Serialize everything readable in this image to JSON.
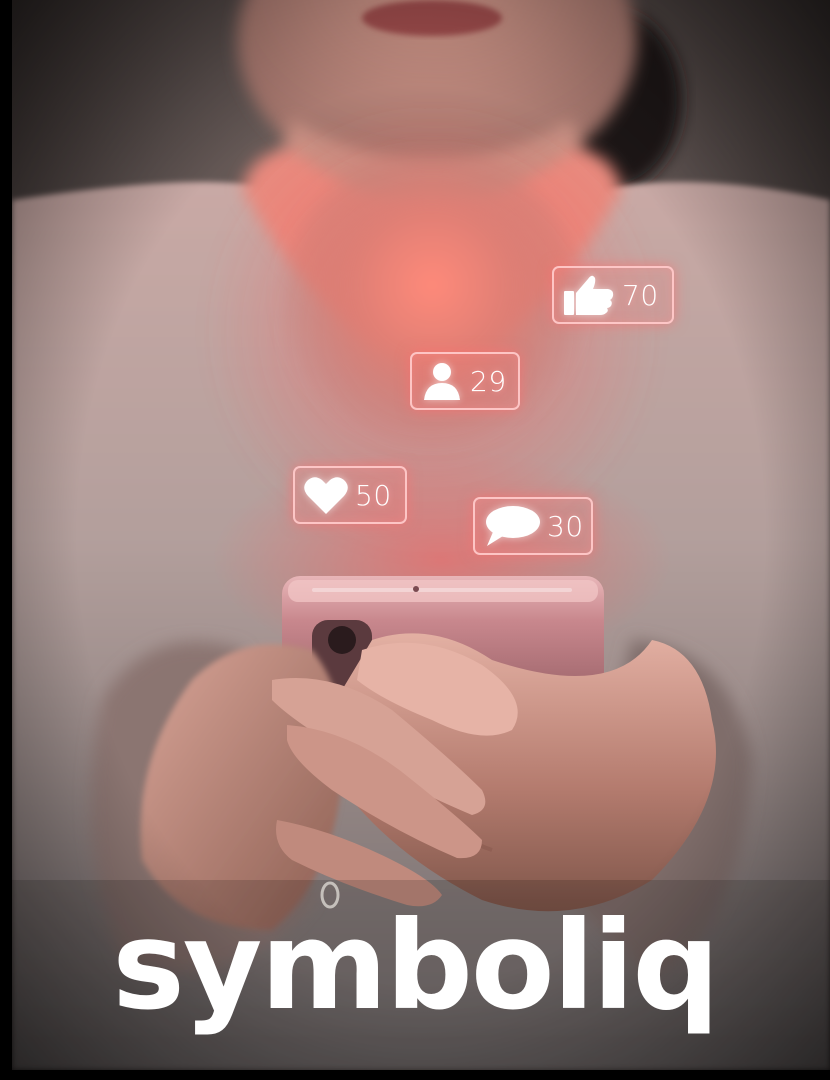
{
  "badges": {
    "likes": {
      "icon": "thumbs-up-icon",
      "count": "70"
    },
    "followers": {
      "icon": "person-icon",
      "count": "29"
    },
    "hearts": {
      "icon": "heart-icon",
      "count": "50"
    },
    "comments": {
      "icon": "speech-bubble-icon",
      "count": "30"
    }
  },
  "brand": {
    "name": "symboliq"
  },
  "colors": {
    "glow": "#ff7070",
    "badge_border": "#ffd0d0",
    "text": "#ffffff",
    "phone": "#c98d92"
  }
}
